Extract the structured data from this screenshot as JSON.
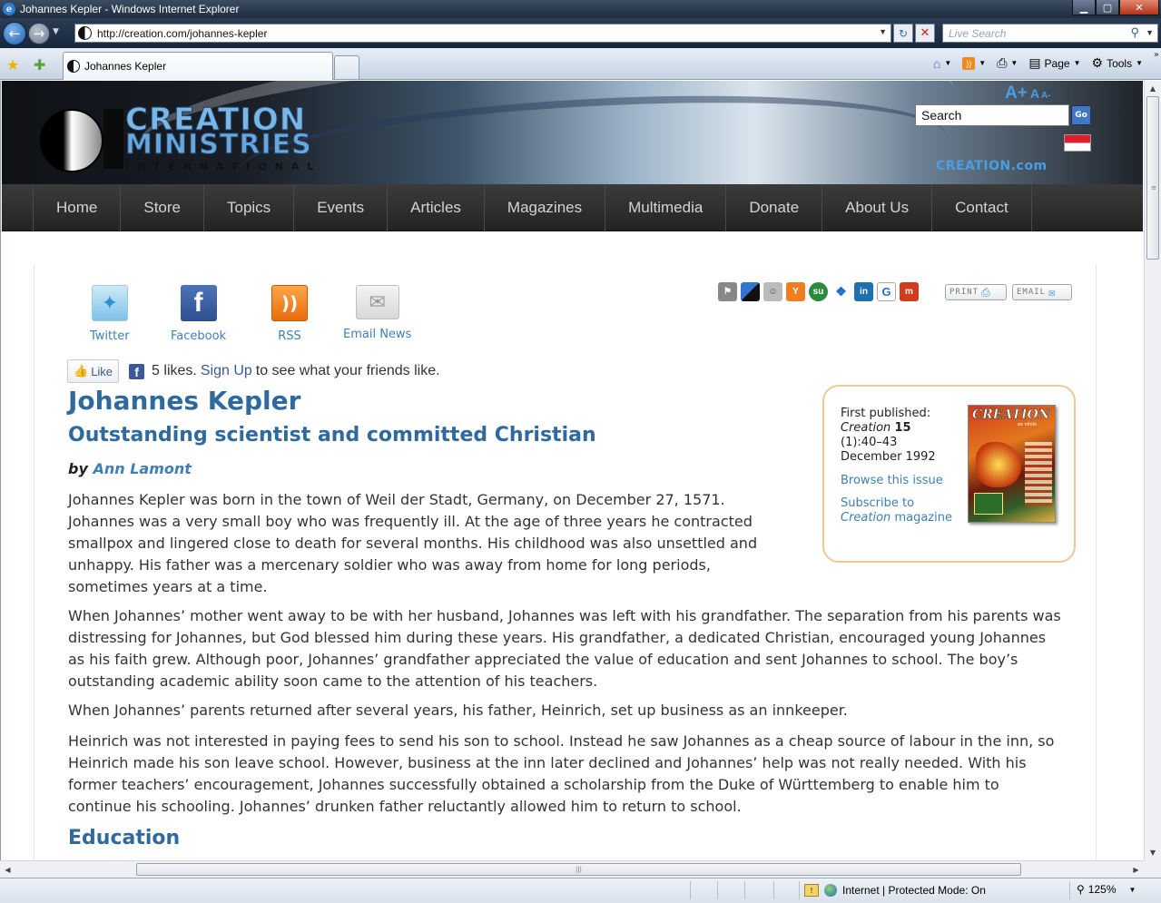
{
  "window": {
    "title": "Johannes Kepler - Windows Internet Explorer",
    "minimize_glyph": "▁",
    "maximize_glyph": "▢",
    "close_glyph": "✕"
  },
  "addressbar": {
    "url": "http://creation.com/johannes-kepler",
    "search_placeholder": "Live Search"
  },
  "tabs": [
    {
      "label": "Johannes Kepler"
    }
  ],
  "commandbar": {
    "page_label": "Page",
    "tools_label": "Tools"
  },
  "statusbar": {
    "zone_text": "Internet | Protected Mode: On",
    "zoom": "125%"
  },
  "site": {
    "logo_line1": "CREATION",
    "logo_line2": "MINISTRIES",
    "logo_line3": "INTERNATIONAL",
    "font_big": "A+",
    "font_mid": "A",
    "font_small": "A-",
    "search_value": "Search",
    "go_label": "Go",
    "domain_label": "CREATION.com"
  },
  "nav": [
    "Home",
    "Store",
    "Topics",
    "Events",
    "Articles",
    "Magazines",
    "Multimedia",
    "Donate",
    "About Us",
    "Contact"
  ],
  "social": {
    "twitter": "Twitter",
    "facebook": "Facebook",
    "rss": "RSS",
    "email_news": "Email News"
  },
  "tools": {
    "print_label": "PRINT",
    "email_label": "EMAIL"
  },
  "like": {
    "button": "Like",
    "count_text": "5 likes.",
    "signup": "Sign Up",
    "rest": "to see what your friends like."
  },
  "article": {
    "title": "Johannes Kepler",
    "subtitle": "Outstanding scientist and committed Christian",
    "by": "by",
    "author": "Ann Lamont",
    "paragraphs": [
      "Johannes Kepler was born in the town of Weil der Stadt, Germany, on December 27, 1571. Johannes was a very small boy who was frequently ill. At the age of three years he contracted smallpox and lingered close to death for several months. His childhood was also unsettled and unhappy. His father was a mercenary soldier who was away from home for long periods, sometimes years at a time.",
      "When Johannes’ mother went away to be with her husband, Johannes was left with his grandfather. The separation from his parents was distressing for Johannes, but God blessed him during these years. His grandfather, a dedicated Christian, encouraged young Johannes as his faith grew. Although poor, Johannes’ grandfather appreciated the value of education and sent Johannes to school. The boy’s outstanding academic ability soon came to the attention of his teachers.",
      "When Johannes’ parents returned after several years, his father, Heinrich, set up business as an innkeeper.",
      "Heinrich was not interested in paying fees to send his son to school. Instead he saw Johannes as a cheap source of labour in the inn, so Heinrich made his son leave school. However, business at the inn later declined and Johannes’ help was not really needed. With his former teachers’ encouragement, Johannes successfully obtained a scholarship from the Duke of Württemberg to enable him to continue his schooling. Johannes’ drunken father reluctantly allowed him to return to school."
    ],
    "section_heading": "Education"
  },
  "publication": {
    "first_published": "First published:",
    "magazine": "Creation",
    "volume": "15",
    "issue": "(1):40–43",
    "date": "December 1992",
    "browse_link": "Browse this issue",
    "subscribe_prefix": "Subscribe to",
    "subscribe_magazine": "Creation",
    "subscribe_suffix": "magazine",
    "cover_title": "CREATION",
    "cover_sub": "ex nihilo"
  },
  "colors": {
    "link_blue": "#3f7fb5",
    "heading_blue": "#2e6a9e",
    "nav_bg": "#2f2f2f",
    "pub_border": "#f0c896"
  }
}
